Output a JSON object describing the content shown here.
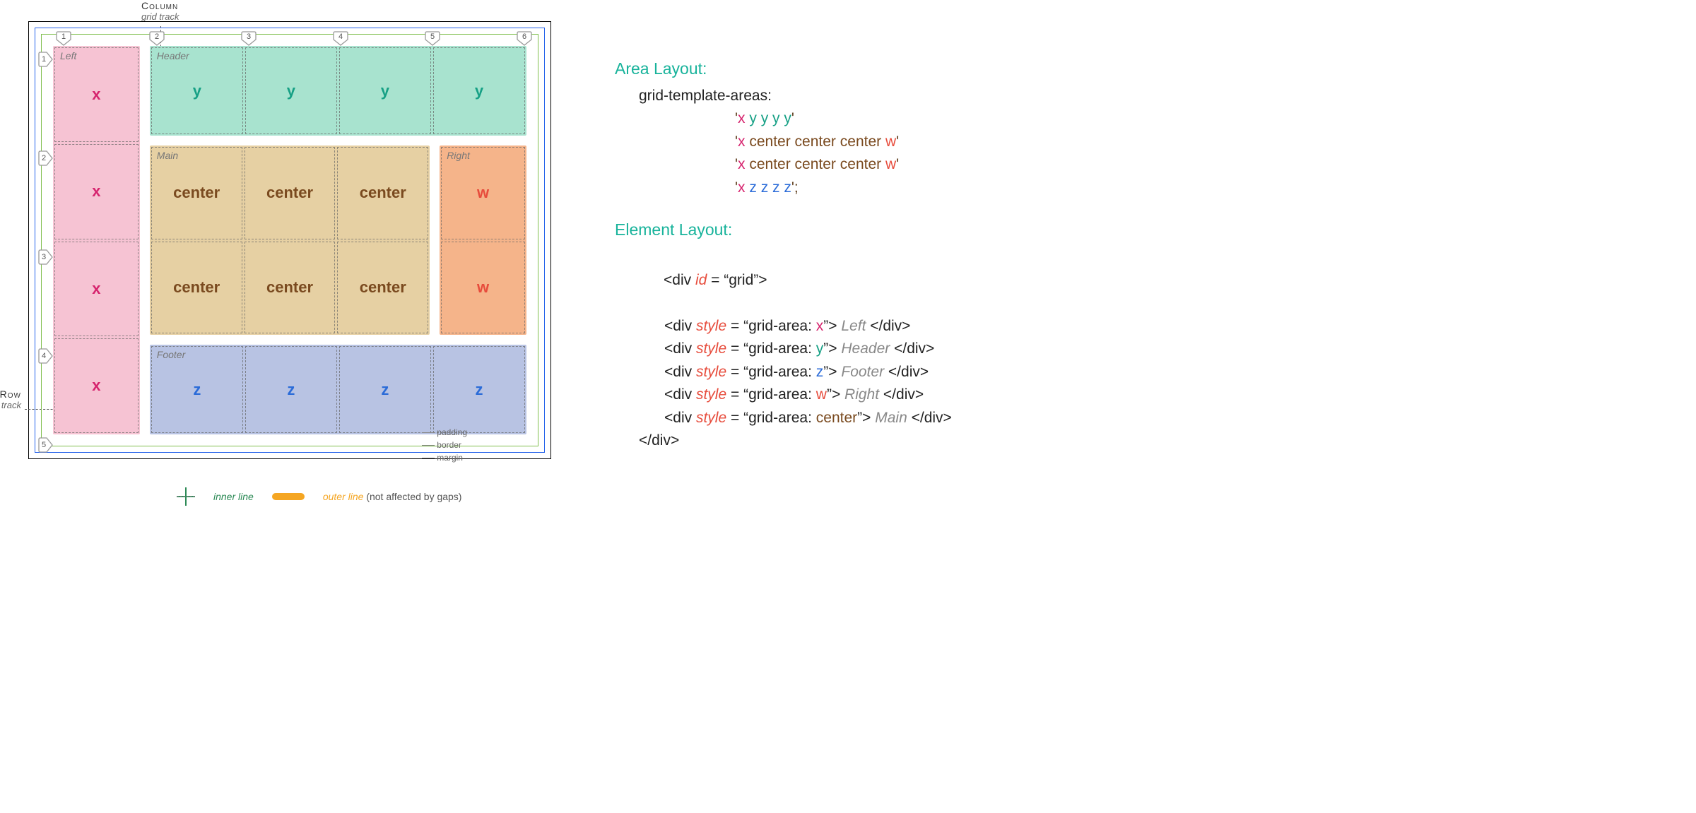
{
  "outside_labels": {
    "column_title": "Column",
    "column_sub": "grid track",
    "row_title": "Row",
    "row_sub": "grid track"
  },
  "line_numbers": {
    "cols": [
      "1",
      "2",
      "3",
      "4",
      "5",
      "6"
    ],
    "rows": [
      "1",
      "2",
      "3",
      "4",
      "5"
    ]
  },
  "areas": {
    "left": {
      "title": "Left",
      "token": "x"
    },
    "header": {
      "title": "Header",
      "token": "y"
    },
    "main": {
      "title": "Main",
      "token": "center"
    },
    "right": {
      "title": "Right",
      "token": "w"
    },
    "footer": {
      "title": "Footer",
      "token": "z"
    }
  },
  "box_callouts": {
    "padding": "padding",
    "border": "border",
    "margin": "margin"
  },
  "legend": {
    "inner": "inner line",
    "outer": "outer line",
    "outer_note": "(not affected by gaps)"
  },
  "right": {
    "area_title": "Area Layout:",
    "gta": "grid-template-areas:",
    "rows": [
      [
        [
          "'",
          "str"
        ],
        [
          "x",
          "pink-x"
        ],
        [
          " ",
          "str"
        ],
        [
          "y y y y",
          "grn-y"
        ],
        [
          "'",
          "str"
        ]
      ],
      [
        [
          "'",
          "str"
        ],
        [
          "x",
          "pink-x"
        ],
        [
          " ",
          "str"
        ],
        [
          "center center center",
          "brn-c"
        ],
        [
          " ",
          "str"
        ],
        [
          "w",
          "red-w"
        ],
        [
          "'",
          "str"
        ]
      ],
      [
        [
          "'",
          "str"
        ],
        [
          "x",
          "pink-x"
        ],
        [
          " ",
          "str"
        ],
        [
          "center center center",
          "brn-c"
        ],
        [
          " ",
          "str"
        ],
        [
          "w",
          "red-w"
        ],
        [
          "'",
          "str"
        ]
      ],
      [
        [
          "'",
          "str"
        ],
        [
          "x",
          "pink-x"
        ],
        [
          " ",
          "str"
        ],
        [
          "z z z z",
          "blue-z"
        ],
        [
          "';",
          "str"
        ]
      ]
    ],
    "elem_title": "Element Layout:",
    "container_open": {
      "tag": "<div ",
      "id_kw": "id",
      "rest": " = “grid”>"
    },
    "children": [
      {
        "area": "x",
        "label": "Left",
        "cls": "pink-x"
      },
      {
        "area": "y",
        "label": "Header",
        "cls": "grn-y"
      },
      {
        "area": "z",
        "label": "Footer",
        "cls": "blue-z"
      },
      {
        "area": "w",
        "label": "Right",
        "cls": "red-w"
      },
      {
        "area": "center",
        "label": "Main",
        "cls": "brn-c"
      }
    ],
    "container_close": "</div>"
  }
}
